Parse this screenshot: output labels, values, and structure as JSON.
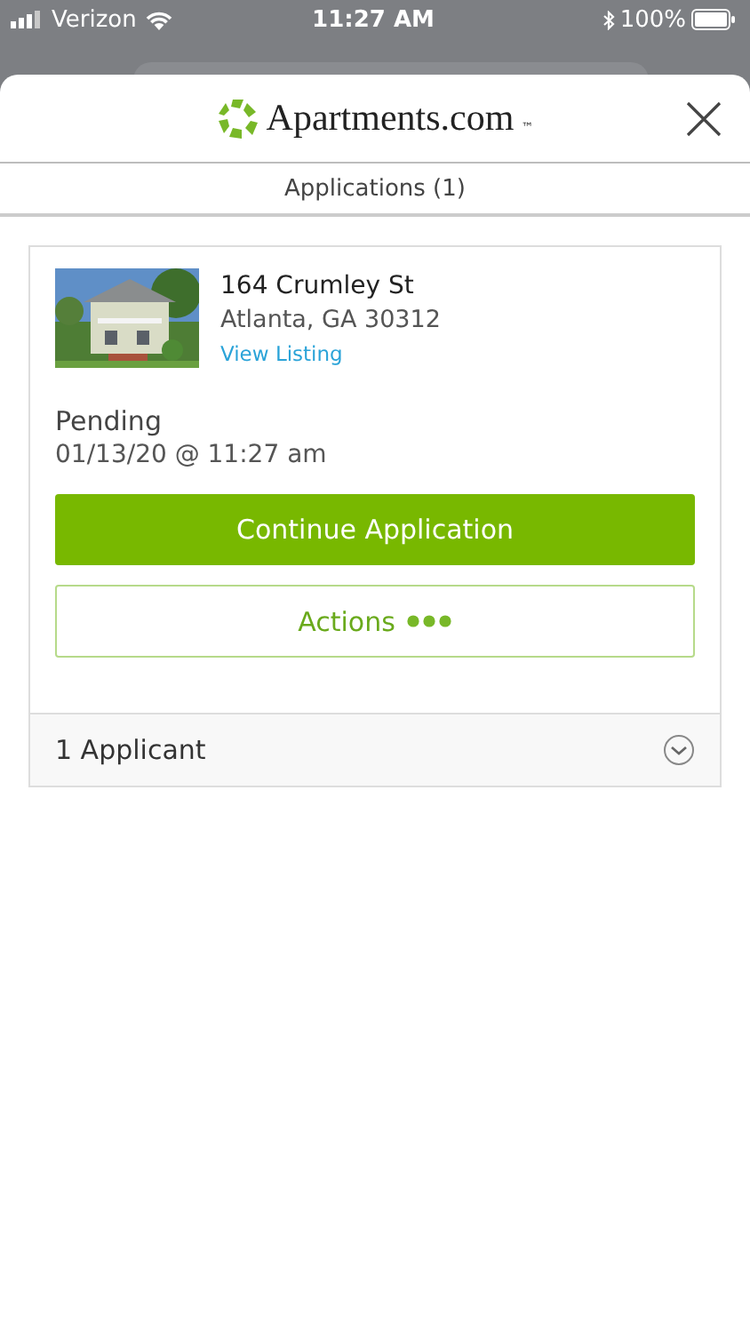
{
  "status_bar": {
    "carrier": "Verizon",
    "time": "11:27 AM",
    "battery": "100%"
  },
  "header": {
    "logo_text": "Apartments.com",
    "logo_mark": "™"
  },
  "tab": {
    "label": "Applications (1)",
    "selected": true
  },
  "application": {
    "street": "164 Crumley St",
    "city": "Atlanta, GA 30312",
    "link": "View Listing",
    "status": "Pending",
    "date": "01/13/20 @ 11:27 am",
    "primary_button": "Continue Application",
    "secondary_button": "Actions",
    "applicants": {
      "label": "1 Applicant",
      "expanded": false
    }
  }
}
